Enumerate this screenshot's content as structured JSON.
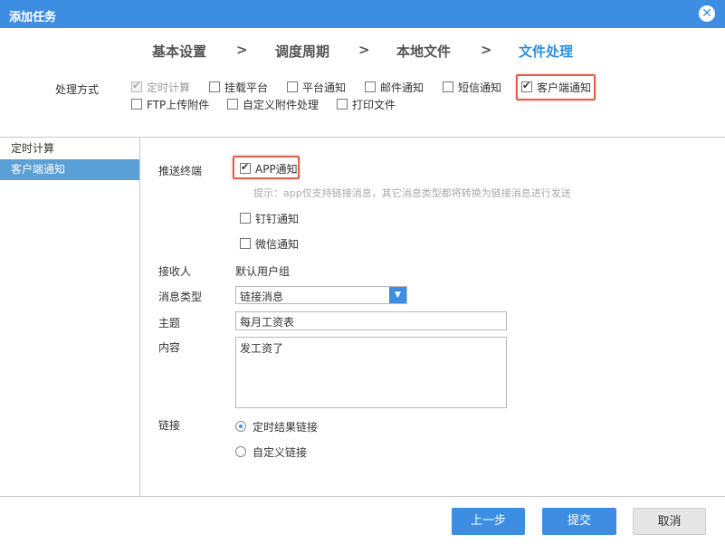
{
  "dialog": {
    "title": "添加任务",
    "close_label": "✕"
  },
  "steps": [
    {
      "label": "基本设置"
    },
    {
      "label": "调度周期"
    },
    {
      "label": "本地文件"
    },
    {
      "label": "文件处理"
    }
  ],
  "step_separator": ">",
  "processing": {
    "label": "处理方式",
    "options": [
      {
        "label": "定时计算",
        "checked": true,
        "disabled": true
      },
      {
        "label": "挂载平台",
        "checked": false
      },
      {
        "label": "平台通知",
        "checked": false
      },
      {
        "label": "邮件通知",
        "checked": false
      },
      {
        "label": "短信通知",
        "checked": false
      },
      {
        "label": "客户端通知",
        "checked": true
      },
      {
        "label": "FTP上传附件",
        "checked": false
      },
      {
        "label": "自定义附件处理",
        "checked": false
      },
      {
        "label": "打印文件",
        "checked": false
      }
    ]
  },
  "sidebar": {
    "items": [
      {
        "label": "定时计算",
        "active": false
      },
      {
        "label": "客户端通知",
        "active": true
      }
    ]
  },
  "form": {
    "push_label": "推送终端",
    "push_options": [
      {
        "label": "APP通知",
        "checked": true
      },
      {
        "label": "钉钉通知",
        "checked": false
      },
      {
        "label": "微信通知",
        "checked": false
      }
    ],
    "hint": "提示：app仅支持链接消息，其它消息类型都将转换为链接消息进行发送",
    "receiver_label": "接收人",
    "receiver_value": "默认用户组",
    "msgtype_label": "消息类型",
    "msgtype_value": "链接消息",
    "subject_label": "主题",
    "subject_value": "每月工资表",
    "content_label": "内容",
    "content_value": "发工资了",
    "link_label": "链接",
    "link_options": [
      {
        "label": "定时结果链接",
        "checked": true
      },
      {
        "label": "自定义链接",
        "checked": false
      }
    ]
  },
  "footer": {
    "prev_label": "上一步",
    "submit_label": "提交",
    "cancel_label": "取消"
  },
  "colors": {
    "accent": "#3d8ee2",
    "highlight": "#e0604f",
    "sidebar_active": "#5b9fd7"
  }
}
